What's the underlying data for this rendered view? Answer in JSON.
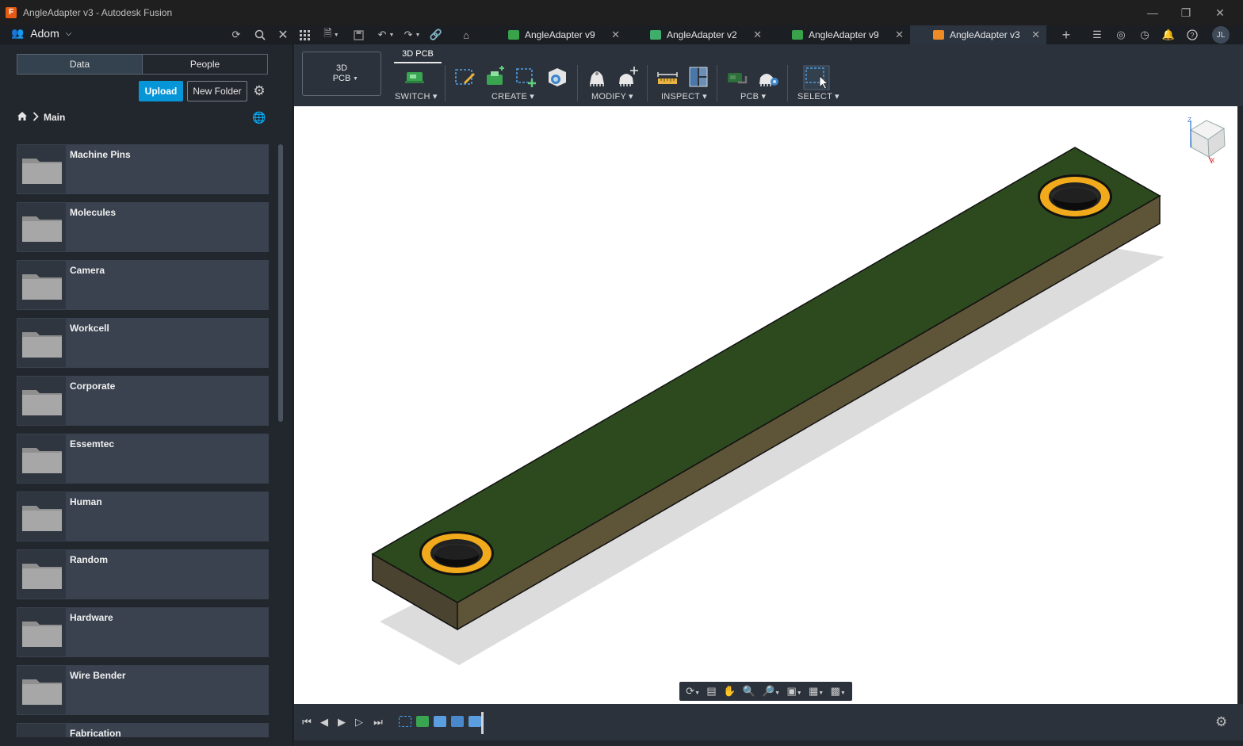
{
  "window": {
    "title": "AngleAdapter v3 - Autodesk Fusion",
    "minimize_icon": "minimize-icon",
    "restore_icon": "restore-icon",
    "close_icon": "close-icon"
  },
  "topbar": {
    "team_name": "Adom",
    "tabs": [
      {
        "label": "AngleAdapter v9",
        "icon": "pcb-document-icon",
        "active": false
      },
      {
        "label": "AngleAdapter v2",
        "icon": "schematic-document-icon",
        "active": false
      },
      {
        "label": "AngleAdapter v9",
        "icon": "pcb-document-icon",
        "active": false
      },
      {
        "label": "AngleAdapter v3",
        "icon": "3d-component-icon",
        "active": true
      }
    ],
    "avatar_initials": "JL"
  },
  "data_panel": {
    "tab_data": "Data",
    "tab_people": "People",
    "upload_label": "Upload",
    "new_folder_label": "New Folder",
    "breadcrumb": {
      "current": "Main"
    },
    "folders": [
      "Machine Pins",
      "Molecules",
      "Camera",
      "Workcell",
      "Corporate",
      "Essemtec",
      "Human",
      "Random",
      "Hardware",
      "Wire Bender",
      "Fabrication"
    ]
  },
  "toolbar": {
    "workspace_line1": "3D",
    "workspace_line2": "PCB",
    "ribbon_tab": "3D PCB",
    "groups": {
      "switch": "SWITCH",
      "create": "CREATE",
      "modify": "MODIFY",
      "inspect": "INSPECT",
      "pcb": "PCB",
      "select": "SELECT"
    }
  },
  "colors": {
    "accent_blue": "#0696d7",
    "board_top": "#2d4a1f",
    "board_front": "#5e5438",
    "board_side": "#4d4530",
    "pad_gold": "#f0aa1b"
  }
}
